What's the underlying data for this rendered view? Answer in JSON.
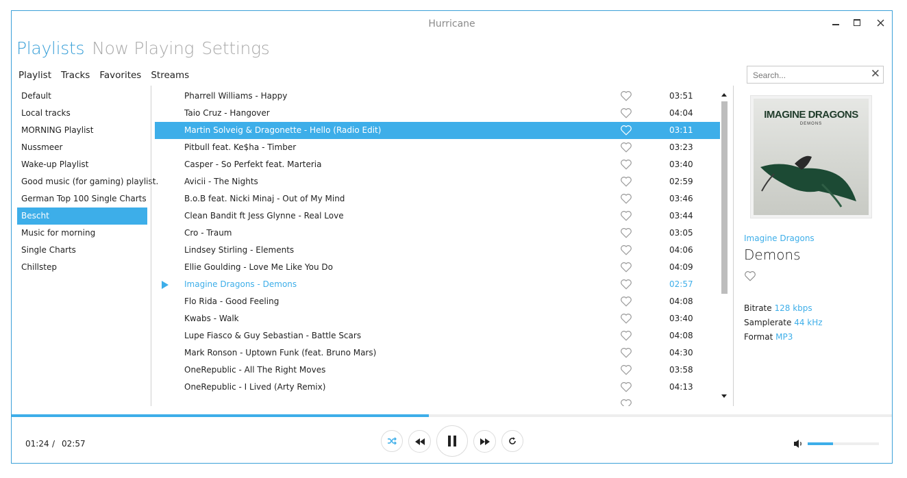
{
  "window": {
    "title": "Hurricane",
    "minimize": "—",
    "maximize": "☐",
    "close": "✕"
  },
  "main_tabs": [
    {
      "label": "Playlists",
      "active": true
    },
    {
      "label": "Now Playing",
      "active": false
    },
    {
      "label": "Settings",
      "active": false
    }
  ],
  "sub_tabs": [
    "Playlist",
    "Tracks",
    "Favorites",
    "Streams"
  ],
  "search": {
    "placeholder": "Search...",
    "value": "",
    "clear": "✕"
  },
  "playlists": [
    {
      "label": "Default",
      "selected": false
    },
    {
      "label": "Local tracks",
      "selected": false
    },
    {
      "label": "MORNING Playlist",
      "selected": false
    },
    {
      "label": "Nussmeer",
      "selected": false
    },
    {
      "label": "Wake-up Playlist",
      "selected": false
    },
    {
      "label": "Good music (for gaming) playlist.",
      "selected": false
    },
    {
      "label": "German Top 100 Single Charts",
      "selected": false
    },
    {
      "label": "Bescht",
      "selected": true
    },
    {
      "label": "Music for morning",
      "selected": false
    },
    {
      "label": "Single Charts",
      "selected": false
    },
    {
      "label": "Chillstep",
      "selected": false
    }
  ],
  "tracks": [
    {
      "name": "Pharrell Williams - Happy",
      "duration": "03:51",
      "selected": false,
      "playing": false
    },
    {
      "name": "Taio Cruz - Hangover",
      "duration": "04:04",
      "selected": false,
      "playing": false
    },
    {
      "name": "Martin Solveig & Dragonette - Hello (Radio Edit)",
      "duration": "03:11",
      "selected": true,
      "playing": false
    },
    {
      "name": "Pitbull feat. Ke$ha - Timber",
      "duration": "03:23",
      "selected": false,
      "playing": false
    },
    {
      "name": "Casper - So Perfekt feat. Marteria",
      "duration": "03:40",
      "selected": false,
      "playing": false
    },
    {
      "name": "Avicii  - The Nights",
      "duration": "02:59",
      "selected": false,
      "playing": false
    },
    {
      "name": "B.o.B feat. Nicki Minaj - Out of My Mind",
      "duration": "03:46",
      "selected": false,
      "playing": false
    },
    {
      "name": "Clean Bandit ft Jess Glynne - Real Love",
      "duration": "03:44",
      "selected": false,
      "playing": false
    },
    {
      "name": "Cro - Traum",
      "duration": "03:05",
      "selected": false,
      "playing": false
    },
    {
      "name": "Lindsey Stirling - Elements",
      "duration": "04:06",
      "selected": false,
      "playing": false
    },
    {
      "name": "Ellie Goulding - Love Me Like You Do",
      "duration": "04:09",
      "selected": false,
      "playing": false
    },
    {
      "name": "Imagine Dragons - Demons",
      "duration": "02:57",
      "selected": false,
      "playing": true
    },
    {
      "name": "Flo Rida - Good Feeling",
      "duration": "04:08",
      "selected": false,
      "playing": false
    },
    {
      "name": "Kwabs - Walk",
      "duration": "03:40",
      "selected": false,
      "playing": false
    },
    {
      "name": "Lupe Fiasco & Guy Sebastian - Battle Scars",
      "duration": "04:08",
      "selected": false,
      "playing": false
    },
    {
      "name": "Mark Ronson - Uptown Funk (feat. Bruno Mars)",
      "duration": "04:30",
      "selected": false,
      "playing": false
    },
    {
      "name": "OneRepublic - All The Right Moves",
      "duration": "03:58",
      "selected": false,
      "playing": false
    },
    {
      "name": "OneRepublic - I Lived (Arty Remix)",
      "duration": "04:13",
      "selected": false,
      "playing": false
    },
    {
      "name": "",
      "duration": "",
      "selected": false,
      "playing": false
    }
  ],
  "now_playing": {
    "cover_band": "IMAGINE DRAGONS",
    "cover_title": "DEMONS",
    "artist": "Imagine Dragons",
    "title": "Demons",
    "bitrate_label": "Bitrate",
    "bitrate": "128 kbps",
    "samplerate_label": "Samplerate",
    "samplerate": "44 kHz",
    "format_label": "Format",
    "format": "MP3"
  },
  "player": {
    "position": "01:24",
    "separator": "/",
    "length": "02:57",
    "progress": 0.474,
    "volume": 0.36,
    "controls": [
      "shuffle-icon",
      "previous-icon",
      "pause-icon",
      "next-icon",
      "repeat-icon"
    ]
  },
  "colors": {
    "accent": "#3daee9",
    "border": "#3aa0d8",
    "text": "#222222",
    "muted": "#a9a9a9"
  }
}
